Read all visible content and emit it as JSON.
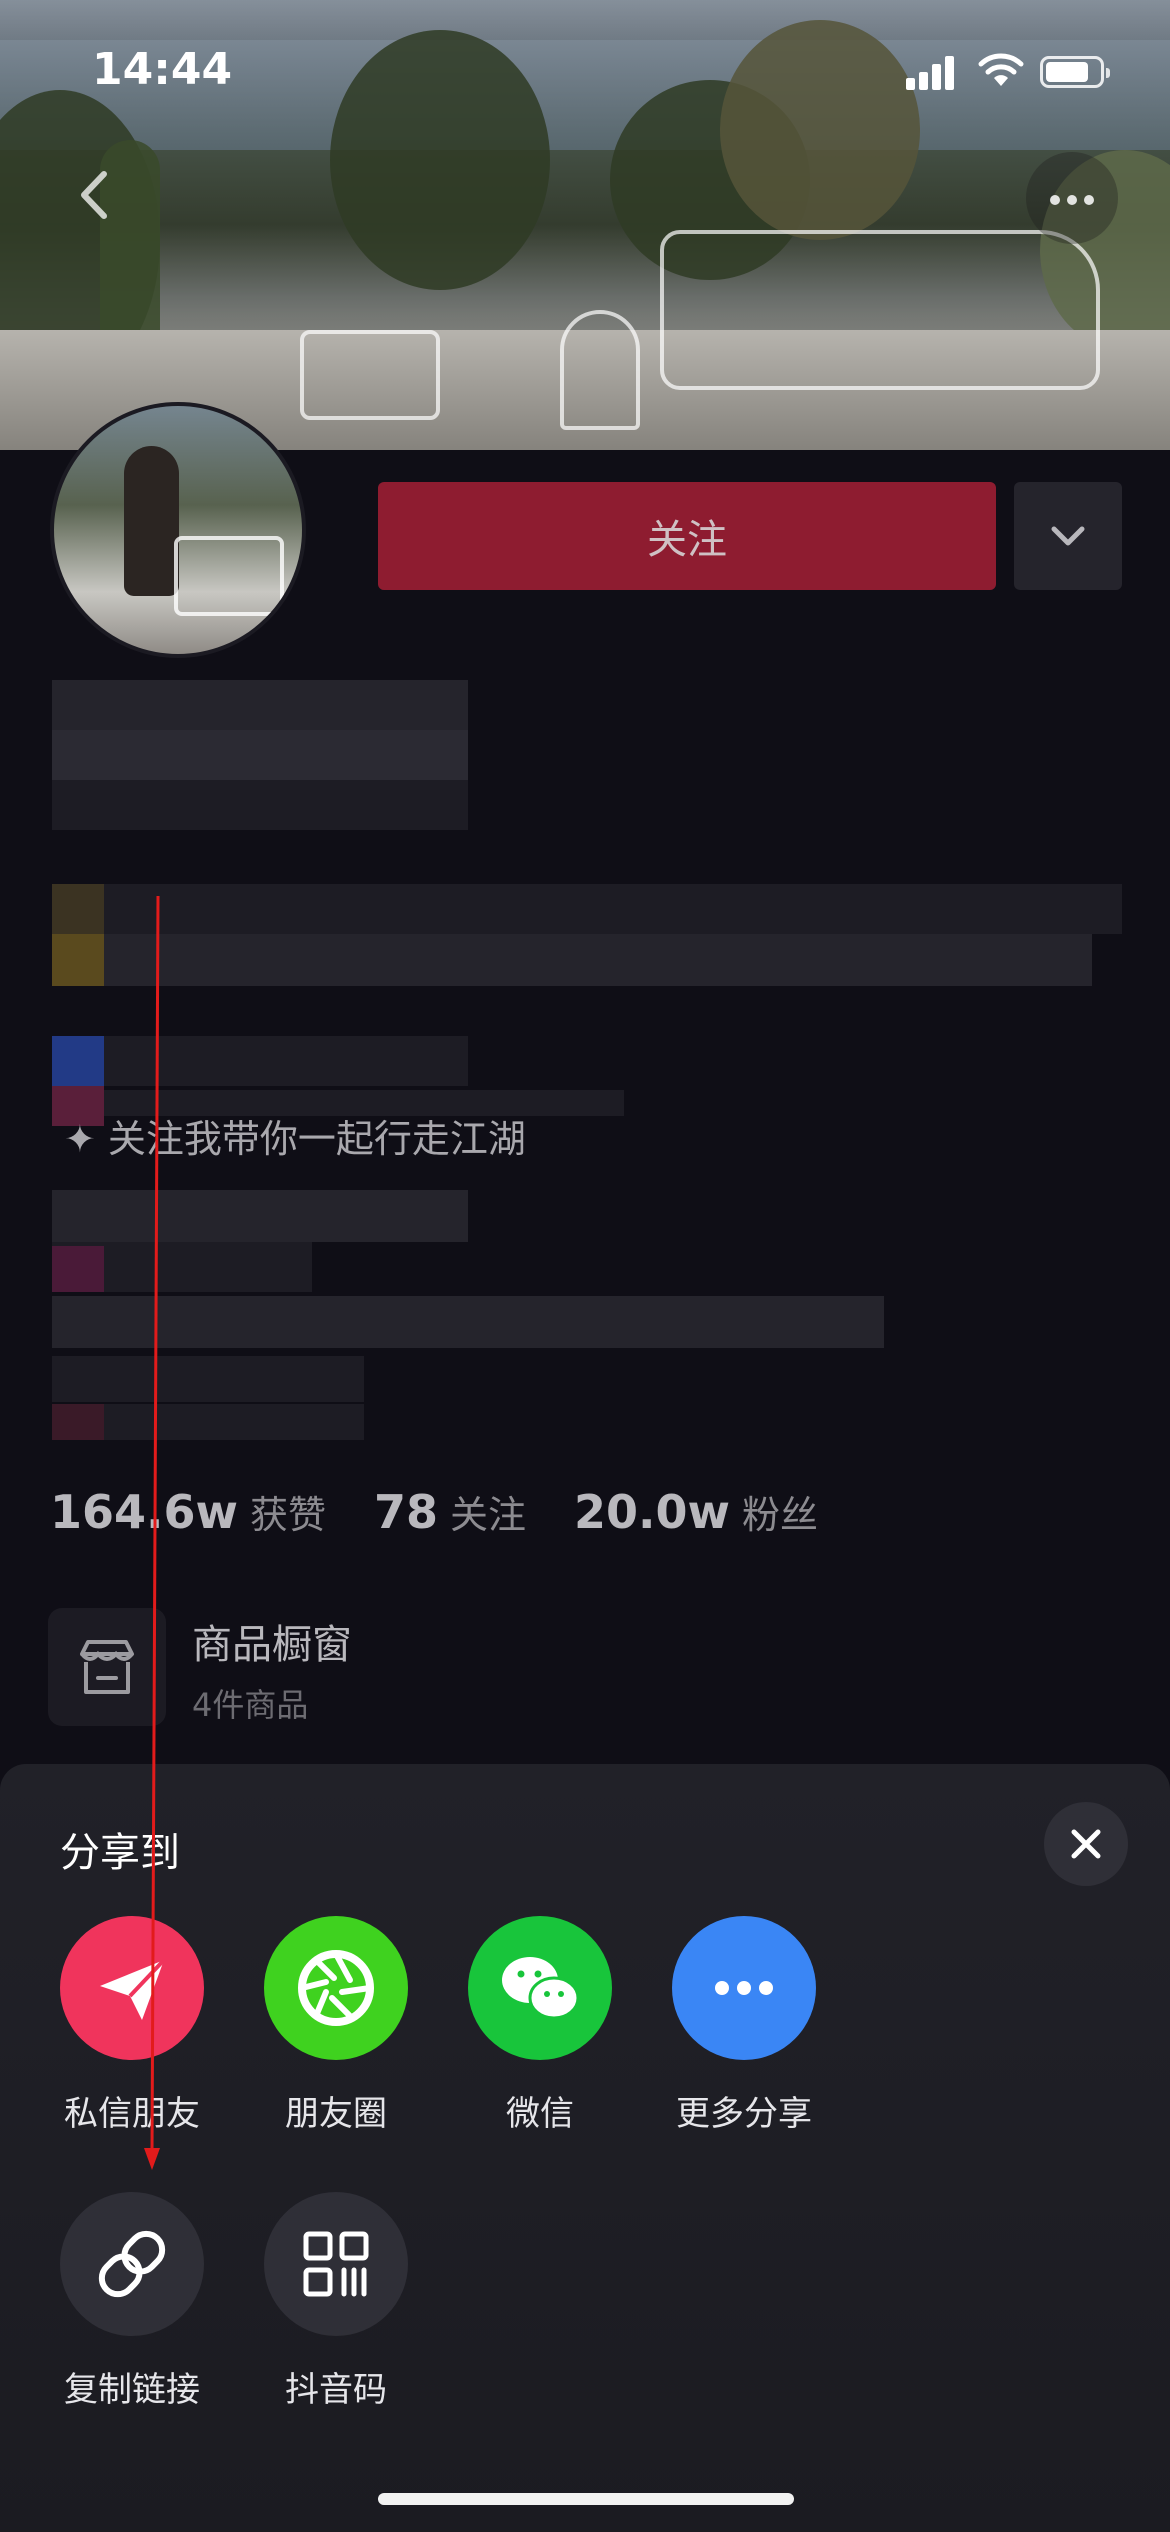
{
  "status_bar": {
    "time": "14:44"
  },
  "header": {
    "back_icon": "chevron-left-icon",
    "more_icon": "ellipsis-icon"
  },
  "profile": {
    "follow_label": "关注",
    "bio_visible_line": "✦ 关注我带你一起行走江湖",
    "stats": [
      {
        "value": "164.6w",
        "label": "获赞"
      },
      {
        "value": "78",
        "label": "关注"
      },
      {
        "value": "20.0w",
        "label": "粉丝"
      }
    ],
    "shop": {
      "title": "商品橱窗",
      "subtitle": "4件商品"
    }
  },
  "share_sheet": {
    "title": "分享到",
    "row1": [
      {
        "label": "私信朋友",
        "icon": "paper-plane-icon",
        "color": "#f0345c"
      },
      {
        "label": "朋友圈",
        "icon": "moments-aperture-icon",
        "color": "#3fd21f"
      },
      {
        "label": "微信",
        "icon": "wechat-icon",
        "color": "#18c53b"
      },
      {
        "label": "更多分享",
        "icon": "more-dots-icon",
        "color": "#3a86f5"
      }
    ],
    "row2": [
      {
        "label": "复制链接",
        "icon": "link-icon",
        "color": "#2f2f37"
      },
      {
        "label": "抖音码",
        "icon": "qr-code-icon",
        "color": "#2f2f37"
      }
    ]
  },
  "colors": {
    "follow": "#8e1c30",
    "background": "#0f0e16",
    "annotation_arrow": "#e21b1b"
  }
}
